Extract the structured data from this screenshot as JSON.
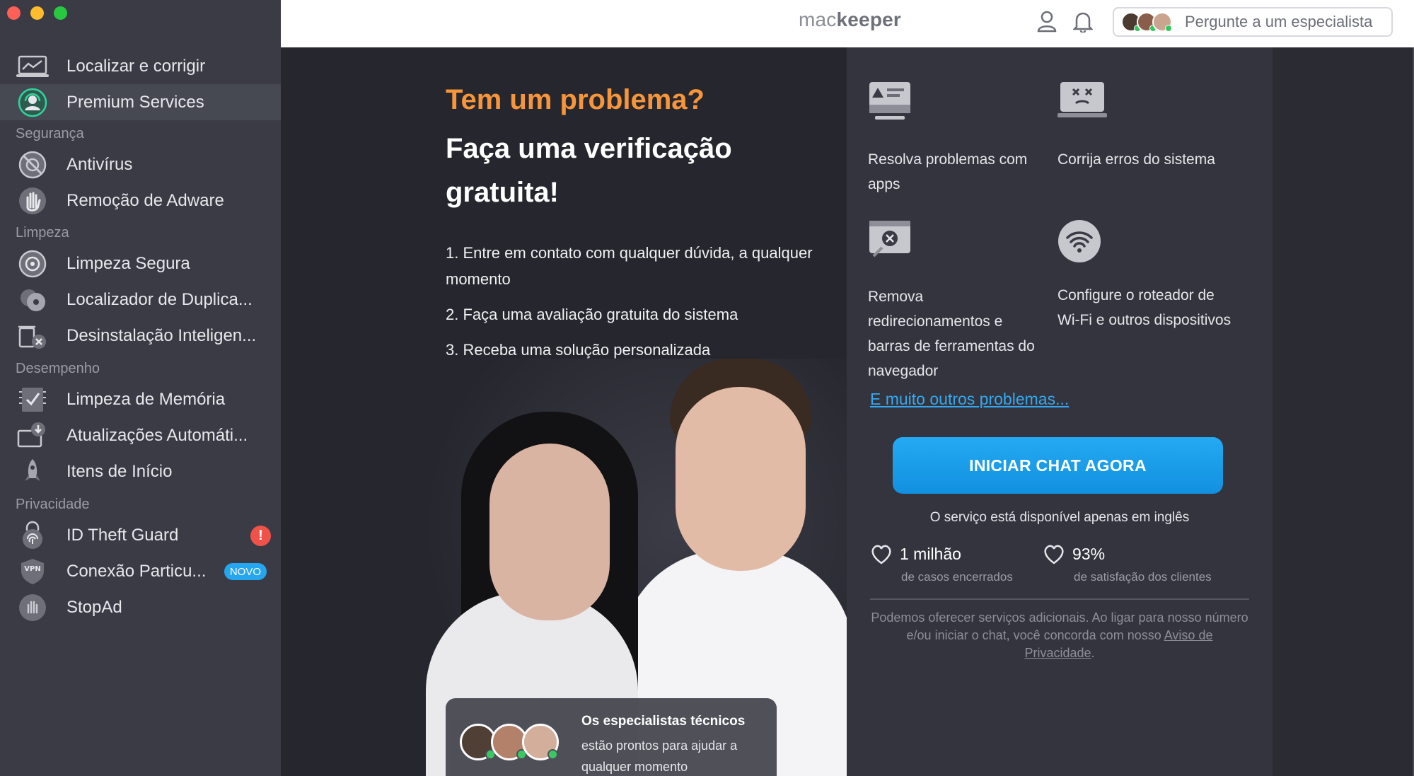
{
  "window": {
    "controls": [
      "close",
      "minimize",
      "maximize"
    ]
  },
  "topbar": {
    "logo_light": "mac",
    "logo_bold": "keeper",
    "ask_expert_label": "Pergunte a um especialista"
  },
  "sidebar": {
    "top_items": [
      {
        "label": "Localizar e corrigir",
        "icon": "laptop-chart-icon"
      },
      {
        "label": "Premium Services",
        "icon": "headset-agent-icon",
        "active": true
      }
    ],
    "sections": {
      "security": "Segurança",
      "cleaning": "Limpeza",
      "performance": "Desempenho",
      "privacy": "Privacidade"
    },
    "security_items": [
      {
        "label": "Antivírus",
        "icon": "antivirus-icon"
      },
      {
        "label": "Remoção de Adware",
        "icon": "hand-stop-icon"
      }
    ],
    "cleaning_items": [
      {
        "label": "Limpeza Segura",
        "icon": "safe-cleanup-icon"
      },
      {
        "label": "Localizador de Duplica...",
        "icon": "duplicates-icon"
      },
      {
        "label": "Desinstalação Inteligen...",
        "icon": "uninstaller-icon"
      }
    ],
    "performance_items": [
      {
        "label": "Limpeza de Memória",
        "icon": "memory-check-icon"
      },
      {
        "label": "Atualizações Automáti...",
        "icon": "update-download-icon"
      },
      {
        "label": "Itens de Início",
        "icon": "rocket-icon"
      }
    ],
    "privacy_items": [
      {
        "label": "ID Theft Guard",
        "icon": "fingerprint-lock-icon",
        "badge": "!"
      },
      {
        "label": "Conexão Particu...",
        "icon": "vpn-shield-icon",
        "badge": "NOVO"
      },
      {
        "label": "StopAd",
        "icon": "stopad-hand-icon"
      }
    ]
  },
  "hero": {
    "title_orange": "Tem um problema?",
    "title_white": "Faça uma verificação gratuita!",
    "steps": [
      "1. Entre em contato com qualquer dúvida, a qualquer momento",
      "2. Faça uma avaliação gratuita do sistema",
      "3. Receba uma solução personalizada"
    ],
    "card_title": "Os especialistas técnicos",
    "card_text": "estão prontos para ajudar a qualquer momento"
  },
  "features": [
    {
      "label": "Resolva problemas com apps",
      "icon": "app-warning-icon"
    },
    {
      "label": "Corrija erros do sistema",
      "icon": "system-error-icon"
    },
    {
      "label": "Remova redirecionamentos e barras de ferramentas do navegador",
      "icon": "browser-close-icon"
    },
    {
      "label": "Configure o roteador de Wi-Fi e outros dispositivos",
      "icon": "wifi-icon"
    }
  ],
  "more_problems_link": "E muito outros problemas...",
  "chat_button": "INICIAR CHAT AGORA",
  "availability_note": "O serviço está disponível apenas em inglês",
  "stats": [
    {
      "value": "1 milhão",
      "caption": "de casos encerrados"
    },
    {
      "value": "93%",
      "caption": "de satisfação dos clientes"
    }
  ],
  "disclaimer": {
    "text": "Podemos oferecer serviços adicionais. Ao ligar para nosso número e/ou iniciar o chat, você concorda com nosso",
    "link": "Aviso de Privacidade",
    "end": "."
  },
  "colors": {
    "accent_orange": "#f7953a",
    "accent_blue": "#24aaf2",
    "sidebar_bg": "#3a3b44",
    "main_bg": "#26272e",
    "alert_red": "#f0524a",
    "online_green": "#36c660"
  }
}
